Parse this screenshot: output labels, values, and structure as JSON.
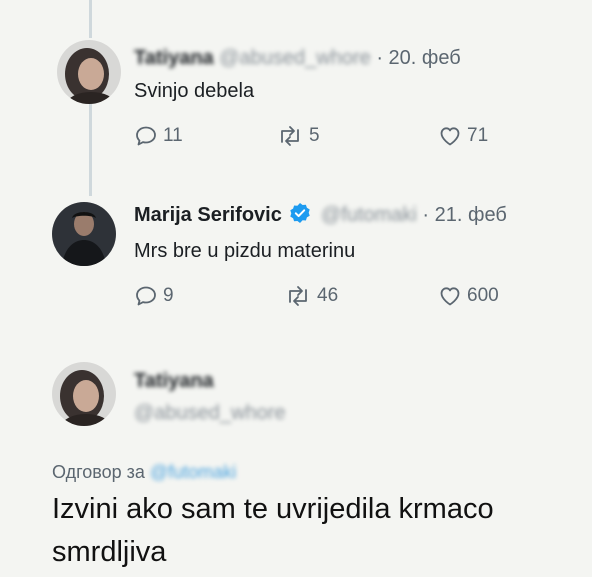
{
  "colors": {
    "accent": "#4aa3df",
    "verified": "#1d9bf0",
    "muted": "#5b6670",
    "thread_line": "#cfd8dc"
  },
  "tweet1": {
    "name": "Tatiyana",
    "handle": "@abused_whore",
    "dot": "·",
    "date": "20. феб",
    "text": "Svinjo debela",
    "replies": "11",
    "retweets": "5",
    "likes": "71"
  },
  "tweet2": {
    "name": "Marija Serifovic",
    "verified_icon": "verified-badge-icon",
    "handle": "@futomaki",
    "dot": "·",
    "date": "21. феб",
    "text": "Mrs bre u pizdu materinu",
    "replies": "9",
    "retweets": "46",
    "likes": "600"
  },
  "tweet3": {
    "name": "Tatiyana",
    "handle": "@abused_whore",
    "reply_label": "Одговор за",
    "reply_mention": "@futomaki",
    "text_line1": "Izvini ako sam te uvrijedila krmaco",
    "text_line2": "smrdljiva"
  }
}
